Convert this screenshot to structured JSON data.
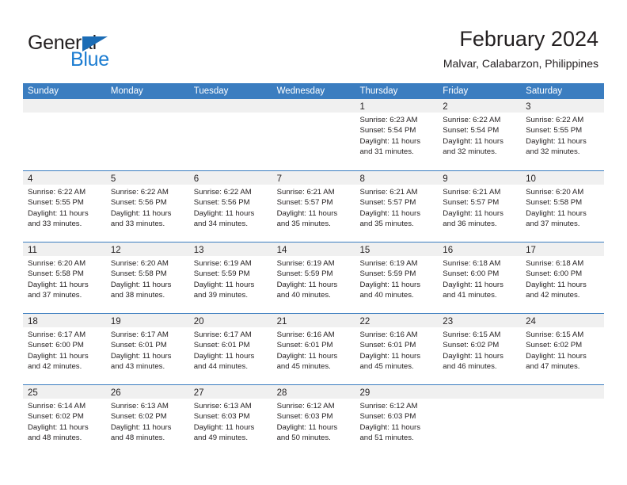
{
  "brand": {
    "name_part1": "General",
    "name_part2": "Blue",
    "triangle_color": "#1b6cb5",
    "blue_color": "#1b7cd1"
  },
  "header": {
    "title": "February 2024",
    "subtitle": "Malvar, Calabarzon, Philippines"
  },
  "theme": {
    "header_blue": "#3b7dc0",
    "numband_gray": "#f0f0f0",
    "text": "#231f20"
  },
  "weekdays": [
    "Sunday",
    "Monday",
    "Tuesday",
    "Wednesday",
    "Thursday",
    "Friday",
    "Saturday"
  ],
  "weeks": [
    [
      {
        "day": "",
        "sunrise": "",
        "sunset": "",
        "daylight": ""
      },
      {
        "day": "",
        "sunrise": "",
        "sunset": "",
        "daylight": ""
      },
      {
        "day": "",
        "sunrise": "",
        "sunset": "",
        "daylight": ""
      },
      {
        "day": "",
        "sunrise": "",
        "sunset": "",
        "daylight": ""
      },
      {
        "day": "1",
        "sunrise": "Sunrise: 6:23 AM",
        "sunset": "Sunset: 5:54 PM",
        "daylight": "Daylight: 11 hours and 31 minutes."
      },
      {
        "day": "2",
        "sunrise": "Sunrise: 6:22 AM",
        "sunset": "Sunset: 5:54 PM",
        "daylight": "Daylight: 11 hours and 32 minutes."
      },
      {
        "day": "3",
        "sunrise": "Sunrise: 6:22 AM",
        "sunset": "Sunset: 5:55 PM",
        "daylight": "Daylight: 11 hours and 32 minutes."
      }
    ],
    [
      {
        "day": "4",
        "sunrise": "Sunrise: 6:22 AM",
        "sunset": "Sunset: 5:55 PM",
        "daylight": "Daylight: 11 hours and 33 minutes."
      },
      {
        "day": "5",
        "sunrise": "Sunrise: 6:22 AM",
        "sunset": "Sunset: 5:56 PM",
        "daylight": "Daylight: 11 hours and 33 minutes."
      },
      {
        "day": "6",
        "sunrise": "Sunrise: 6:22 AM",
        "sunset": "Sunset: 5:56 PM",
        "daylight": "Daylight: 11 hours and 34 minutes."
      },
      {
        "day": "7",
        "sunrise": "Sunrise: 6:21 AM",
        "sunset": "Sunset: 5:57 PM",
        "daylight": "Daylight: 11 hours and 35 minutes."
      },
      {
        "day": "8",
        "sunrise": "Sunrise: 6:21 AM",
        "sunset": "Sunset: 5:57 PM",
        "daylight": "Daylight: 11 hours and 35 minutes."
      },
      {
        "day": "9",
        "sunrise": "Sunrise: 6:21 AM",
        "sunset": "Sunset: 5:57 PM",
        "daylight": "Daylight: 11 hours and 36 minutes."
      },
      {
        "day": "10",
        "sunrise": "Sunrise: 6:20 AM",
        "sunset": "Sunset: 5:58 PM",
        "daylight": "Daylight: 11 hours and 37 minutes."
      }
    ],
    [
      {
        "day": "11",
        "sunrise": "Sunrise: 6:20 AM",
        "sunset": "Sunset: 5:58 PM",
        "daylight": "Daylight: 11 hours and 37 minutes."
      },
      {
        "day": "12",
        "sunrise": "Sunrise: 6:20 AM",
        "sunset": "Sunset: 5:58 PM",
        "daylight": "Daylight: 11 hours and 38 minutes."
      },
      {
        "day": "13",
        "sunrise": "Sunrise: 6:19 AM",
        "sunset": "Sunset: 5:59 PM",
        "daylight": "Daylight: 11 hours and 39 minutes."
      },
      {
        "day": "14",
        "sunrise": "Sunrise: 6:19 AM",
        "sunset": "Sunset: 5:59 PM",
        "daylight": "Daylight: 11 hours and 40 minutes."
      },
      {
        "day": "15",
        "sunrise": "Sunrise: 6:19 AM",
        "sunset": "Sunset: 5:59 PM",
        "daylight": "Daylight: 11 hours and 40 minutes."
      },
      {
        "day": "16",
        "sunrise": "Sunrise: 6:18 AM",
        "sunset": "Sunset: 6:00 PM",
        "daylight": "Daylight: 11 hours and 41 minutes."
      },
      {
        "day": "17",
        "sunrise": "Sunrise: 6:18 AM",
        "sunset": "Sunset: 6:00 PM",
        "daylight": "Daylight: 11 hours and 42 minutes."
      }
    ],
    [
      {
        "day": "18",
        "sunrise": "Sunrise: 6:17 AM",
        "sunset": "Sunset: 6:00 PM",
        "daylight": "Daylight: 11 hours and 42 minutes."
      },
      {
        "day": "19",
        "sunrise": "Sunrise: 6:17 AM",
        "sunset": "Sunset: 6:01 PM",
        "daylight": "Daylight: 11 hours and 43 minutes."
      },
      {
        "day": "20",
        "sunrise": "Sunrise: 6:17 AM",
        "sunset": "Sunset: 6:01 PM",
        "daylight": "Daylight: 11 hours and 44 minutes."
      },
      {
        "day": "21",
        "sunrise": "Sunrise: 6:16 AM",
        "sunset": "Sunset: 6:01 PM",
        "daylight": "Daylight: 11 hours and 45 minutes."
      },
      {
        "day": "22",
        "sunrise": "Sunrise: 6:16 AM",
        "sunset": "Sunset: 6:01 PM",
        "daylight": "Daylight: 11 hours and 45 minutes."
      },
      {
        "day": "23",
        "sunrise": "Sunrise: 6:15 AM",
        "sunset": "Sunset: 6:02 PM",
        "daylight": "Daylight: 11 hours and 46 minutes."
      },
      {
        "day": "24",
        "sunrise": "Sunrise: 6:15 AM",
        "sunset": "Sunset: 6:02 PM",
        "daylight": "Daylight: 11 hours and 47 minutes."
      }
    ],
    [
      {
        "day": "25",
        "sunrise": "Sunrise: 6:14 AM",
        "sunset": "Sunset: 6:02 PM",
        "daylight": "Daylight: 11 hours and 48 minutes."
      },
      {
        "day": "26",
        "sunrise": "Sunrise: 6:13 AM",
        "sunset": "Sunset: 6:02 PM",
        "daylight": "Daylight: 11 hours and 48 minutes."
      },
      {
        "day": "27",
        "sunrise": "Sunrise: 6:13 AM",
        "sunset": "Sunset: 6:03 PM",
        "daylight": "Daylight: 11 hours and 49 minutes."
      },
      {
        "day": "28",
        "sunrise": "Sunrise: 6:12 AM",
        "sunset": "Sunset: 6:03 PM",
        "daylight": "Daylight: 11 hours and 50 minutes."
      },
      {
        "day": "29",
        "sunrise": "Sunrise: 6:12 AM",
        "sunset": "Sunset: 6:03 PM",
        "daylight": "Daylight: 11 hours and 51 minutes."
      },
      {
        "day": "",
        "sunrise": "",
        "sunset": "",
        "daylight": ""
      },
      {
        "day": "",
        "sunrise": "",
        "sunset": "",
        "daylight": ""
      }
    ]
  ]
}
